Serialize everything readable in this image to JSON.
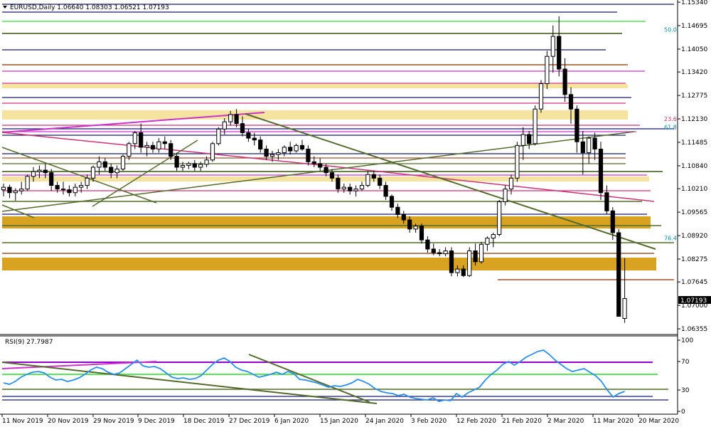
{
  "main_header": "EURUSD,Daily  1.06640 1.08303 1.06521 1.07193",
  "rsi_header": "RSI(9) 27.7987",
  "chart_data": {
    "type": "candlestick",
    "symbol": "EURUSD",
    "timeframe": "Daily",
    "ohlc_header": {
      "open": 1.0664,
      "high": 1.08303,
      "low": 1.06521,
      "close": 1.07193
    },
    "price_axis": {
      "min": 1.062,
      "max": 1.154,
      "ticks": [
        "1.15340",
        "1.14695",
        "1.14050",
        "1.13420",
        "1.12775",
        "1.12130",
        "1.11485",
        "1.10840",
        "1.10210",
        "1.09565",
        "1.08920",
        "1.08275",
        "1.07645",
        "1.07000",
        "1.06355"
      ],
      "current_price_label": "1.07193",
      "current_price": 1.07193
    },
    "date_ticks": [
      "11 Nov 2019",
      "20 Nov 2019",
      "29 Nov 2019",
      "9 Dec 2019",
      "18 Dec 2019",
      "27 Dec 2019",
      "6 Jan 2020",
      "15 Jan 2020",
      "24 Jan 2020",
      "3 Feb 2020",
      "12 Feb 2020",
      "21 Feb 2020",
      "2 Mar 2020",
      "11 Mar 2020",
      "20 Mar 2020"
    ],
    "fib_labels": [
      {
        "text": "50.0",
        "price": 1.1459,
        "color": "#0a8a9a"
      },
      {
        "text": "23.6",
        "price": 1.1213,
        "color": "#c04060"
      },
      {
        "text": "61.8",
        "price": 1.1191,
        "color": "#0a8a9a"
      },
      {
        "text": "76.4",
        "price": 1.0885,
        "color": "#0a8a9a"
      }
    ],
    "candles": [
      [
        1.1018,
        1.1035,
        1.1,
        1.1025
      ],
      [
        1.1025,
        1.1032,
        1.0995,
        1.101
      ],
      [
        1.101,
        1.1022,
        1.0988,
        1.1015
      ],
      [
        1.1015,
        1.104,
        1.1005,
        1.102
      ],
      [
        1.102,
        1.106,
        1.1015,
        1.1055
      ],
      [
        1.1055,
        1.108,
        1.104,
        1.1068
      ],
      [
        1.1068,
        1.1085,
        1.105,
        1.1072
      ],
      [
        1.1072,
        1.109,
        1.105,
        1.1065
      ],
      [
        1.1065,
        1.1075,
        1.1015,
        1.103
      ],
      [
        1.103,
        1.104,
        1.101,
        1.102
      ],
      [
        1.102,
        1.104,
        1.1005,
        1.1018
      ],
      [
        1.1018,
        1.103,
        1.1,
        1.101
      ],
      [
        1.101,
        1.1035,
        1.1,
        1.1025
      ],
      [
        1.1025,
        1.104,
        1.101,
        1.103
      ],
      [
        1.103,
        1.106,
        1.102,
        1.105
      ],
      [
        1.105,
        1.1085,
        1.104,
        1.108
      ],
      [
        1.108,
        1.111,
        1.106,
        1.1095
      ],
      [
        1.1095,
        1.1105,
        1.107,
        1.108
      ],
      [
        1.108,
        1.109,
        1.105,
        1.1065
      ],
      [
        1.1065,
        1.1085,
        1.105,
        1.1075
      ],
      [
        1.1075,
        1.1115,
        1.107,
        1.111
      ],
      [
        1.111,
        1.115,
        1.11,
        1.1145
      ],
      [
        1.1145,
        1.118,
        1.113,
        1.1175
      ],
      [
        1.1175,
        1.12,
        1.112,
        1.1135
      ],
      [
        1.1135,
        1.115,
        1.111,
        1.114
      ],
      [
        1.114,
        1.115,
        1.112,
        1.113
      ],
      [
        1.113,
        1.116,
        1.112,
        1.115
      ],
      [
        1.115,
        1.1165,
        1.113,
        1.1145
      ],
      [
        1.1145,
        1.1155,
        1.11,
        1.111
      ],
      [
        1.111,
        1.112,
        1.107,
        1.108
      ],
      [
        1.108,
        1.1095,
        1.107,
        1.1085
      ],
      [
        1.1085,
        1.1095,
        1.1075,
        1.109
      ],
      [
        1.109,
        1.11,
        1.107,
        1.108
      ],
      [
        1.108,
        1.1095,
        1.107,
        1.1088
      ],
      [
        1.1088,
        1.111,
        1.108,
        1.11
      ],
      [
        1.11,
        1.115,
        1.1095,
        1.1145
      ],
      [
        1.1145,
        1.119,
        1.114,
        1.1185
      ],
      [
        1.1185,
        1.1215,
        1.117,
        1.1205
      ],
      [
        1.1205,
        1.1235,
        1.1195,
        1.1225
      ],
      [
        1.1225,
        1.124,
        1.119,
        1.12
      ],
      [
        1.12,
        1.122,
        1.1165,
        1.1175
      ],
      [
        1.1175,
        1.1185,
        1.115,
        1.116
      ],
      [
        1.116,
        1.1175,
        1.114,
        1.1155
      ],
      [
        1.1155,
        1.1165,
        1.112,
        1.113
      ],
      [
        1.113,
        1.114,
        1.11,
        1.111
      ],
      [
        1.111,
        1.1125,
        1.1095,
        1.1115
      ],
      [
        1.1115,
        1.113,
        1.11,
        1.112
      ],
      [
        1.112,
        1.114,
        1.111,
        1.1135
      ],
      [
        1.1135,
        1.115,
        1.1115,
        1.1125
      ],
      [
        1.1125,
        1.1145,
        1.112,
        1.114
      ],
      [
        1.114,
        1.1155,
        1.1125,
        1.113
      ],
      [
        1.113,
        1.114,
        1.1085,
        1.1095
      ],
      [
        1.1095,
        1.111,
        1.108,
        1.109
      ],
      [
        1.109,
        1.1105,
        1.107,
        1.108
      ],
      [
        1.108,
        1.109,
        1.1055,
        1.1065
      ],
      [
        1.1065,
        1.1075,
        1.104,
        1.105
      ],
      [
        1.105,
        1.106,
        1.101,
        1.102
      ],
      [
        1.102,
        1.1035,
        1.101,
        1.1025
      ],
      [
        1.1025,
        1.1035,
        1.1005,
        1.1015
      ],
      [
        1.1015,
        1.103,
        1.1,
        1.102
      ],
      [
        1.102,
        1.104,
        1.1015,
        1.103
      ],
      [
        1.103,
        1.107,
        1.1025,
        1.106
      ],
      [
        1.106,
        1.107,
        1.104,
        1.105
      ],
      [
        1.105,
        1.106,
        1.102,
        1.103
      ],
      [
        1.103,
        1.104,
        1.099,
        1.1
      ],
      [
        1.1,
        1.1005,
        1.096,
        1.097
      ],
      [
        1.097,
        1.098,
        1.094,
        1.095
      ],
      [
        1.095,
        1.096,
        1.0925,
        1.0935
      ],
      [
        1.0935,
        1.0945,
        1.09,
        1.091
      ],
      [
        1.091,
        1.0925,
        1.09,
        1.0918
      ],
      [
        1.0918,
        1.0925,
        1.087,
        1.088
      ],
      [
        1.088,
        1.089,
        1.0845,
        1.0855
      ],
      [
        1.0855,
        1.087,
        1.0838,
        1.0845
      ],
      [
        1.0845,
        1.0855,
        1.0835,
        1.0842
      ],
      [
        1.0842,
        1.086,
        1.0835,
        1.085
      ],
      [
        1.085,
        1.086,
        1.078,
        1.079
      ],
      [
        1.079,
        1.081,
        1.078,
        1.08
      ],
      [
        1.08,
        1.081,
        1.0778,
        1.0782
      ],
      [
        1.0782,
        1.086,
        1.0778,
        1.085
      ],
      [
        1.085,
        1.087,
        1.081,
        1.082
      ],
      [
        1.082,
        1.0875,
        1.0815,
        1.0868
      ],
      [
        1.0868,
        1.089,
        1.085,
        1.0885
      ],
      [
        1.0885,
        1.09,
        1.086,
        1.0895
      ],
      [
        1.0895,
        1.099,
        1.089,
        1.0985
      ],
      [
        1.0985,
        1.103,
        1.0975,
        1.102
      ],
      [
        1.102,
        1.106,
        1.1005,
        1.105
      ],
      [
        1.105,
        1.115,
        1.104,
        1.114
      ],
      [
        1.114,
        1.119,
        1.11,
        1.117
      ],
      [
        1.117,
        1.118,
        1.113,
        1.1145
      ],
      [
        1.1145,
        1.125,
        1.114,
        1.124
      ],
      [
        1.124,
        1.132,
        1.123,
        1.131
      ],
      [
        1.131,
        1.14,
        1.1295,
        1.1385
      ],
      [
        1.1385,
        1.147,
        1.134,
        1.144
      ],
      [
        1.144,
        1.1495,
        1.133,
        1.135
      ],
      [
        1.135,
        1.138,
        1.126,
        1.128
      ],
      [
        1.128,
        1.13,
        1.12,
        1.124
      ],
      [
        1.124,
        1.125,
        1.112,
        1.115
      ],
      [
        1.115,
        1.118,
        1.106,
        1.112
      ],
      [
        1.112,
        1.1165,
        1.109,
        1.116
      ],
      [
        1.116,
        1.1175,
        1.11,
        1.113
      ],
      [
        1.113,
        1.115,
        1.099,
        1.101
      ],
      [
        1.101,
        1.103,
        1.095,
        1.096
      ],
      [
        1.096,
        1.097,
        1.088,
        1.09
      ],
      [
        1.09,
        1.091,
        1.07,
        1.067
      ],
      [
        1.0664,
        1.083,
        1.0652,
        1.0719
      ]
    ],
    "rsi": {
      "period": 9,
      "value": 27.7987,
      "ylim": [
        0,
        100
      ],
      "ticks": [
        "100",
        "70",
        "30",
        "0"
      ],
      "levels": [
        70,
        30
      ],
      "values": [
        40,
        38,
        42,
        48,
        52,
        55,
        56,
        54,
        48,
        44,
        45,
        42,
        44,
        47,
        52,
        58,
        62,
        60,
        55,
        52,
        54,
        60,
        66,
        72,
        64,
        62,
        63,
        60,
        54,
        48,
        46,
        47,
        45,
        46,
        50,
        58,
        66,
        72,
        75,
        70,
        62,
        58,
        56,
        52,
        48,
        50,
        52,
        55,
        52,
        56,
        53,
        45,
        44,
        42,
        40,
        37,
        34,
        36,
        35,
        37,
        40,
        45,
        42,
        38,
        32,
        28,
        26,
        25,
        22,
        24,
        20,
        18,
        17,
        16,
        19,
        14,
        16,
        15,
        25,
        20,
        26,
        30,
        34,
        44,
        52,
        58,
        66,
        70,
        65,
        70,
        76,
        80,
        84,
        86,
        80,
        72,
        66,
        60,
        56,
        58,
        60,
        55,
        50,
        42,
        30,
        20,
        25,
        28
      ]
    }
  }
}
